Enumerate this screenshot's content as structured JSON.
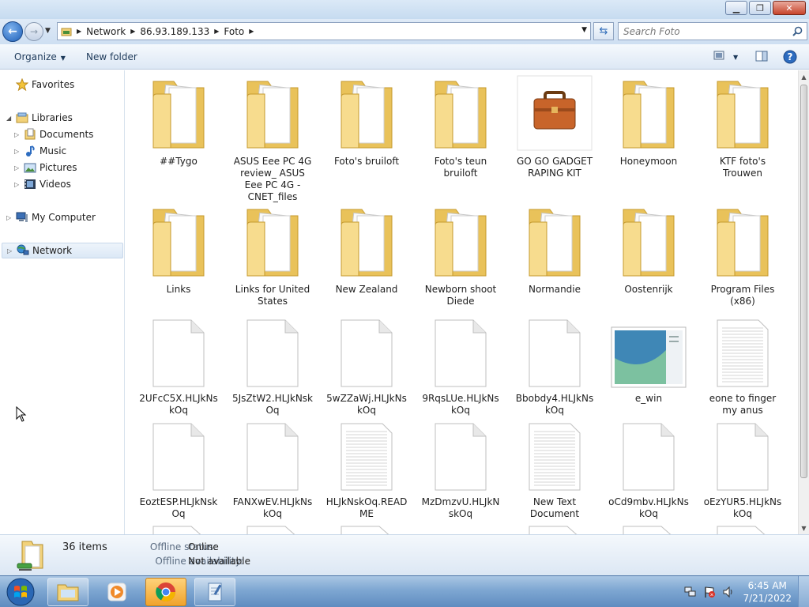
{
  "window": {
    "minimize_icon": "minimize-icon",
    "maximize_icon": "restore-icon",
    "close_icon": "close-icon"
  },
  "address": {
    "crumbs": [
      "Network",
      "86.93.189.133",
      "Foto"
    ],
    "search_placeholder": "Search Foto"
  },
  "toolbar": {
    "organize": "Organize",
    "new_folder": "New folder"
  },
  "nav": {
    "favorites": "Favorites",
    "libraries": "Libraries",
    "documents": "Documents",
    "music": "Music",
    "pictures": "Pictures",
    "videos": "Videos",
    "my_computer": "My Computer",
    "network": "Network"
  },
  "items": [
    {
      "label": "##Tygo",
      "kind": "folder"
    },
    {
      "label": "ASUS Eee PC 4G review_ ASUS Eee PC 4G - CNET_files",
      "kind": "folder"
    },
    {
      "label": "Foto's bruiloft",
      "kind": "folder"
    },
    {
      "label": "Foto's teun bruiloft",
      "kind": "folder"
    },
    {
      "label": "GO GO GADGET RAPING KIT",
      "kind": "briefcase"
    },
    {
      "label": "Honeymoon",
      "kind": "folder"
    },
    {
      "label": "KTF foto's Trouwen",
      "kind": "folder"
    },
    {
      "label": "Links",
      "kind": "folder"
    },
    {
      "label": "Links for United States",
      "kind": "folder"
    },
    {
      "label": "New Zealand",
      "kind": "folder"
    },
    {
      "label": "Newborn shoot Diede",
      "kind": "folder"
    },
    {
      "label": "Normandie",
      "kind": "folder"
    },
    {
      "label": "Oostenrijk",
      "kind": "folder"
    },
    {
      "label": "Program Files (x86)",
      "kind": "folder"
    },
    {
      "label": "2UFcC5X.HLJkNskOq",
      "kind": "file"
    },
    {
      "label": "5JsZtW2.HLJkNskOq",
      "kind": "file"
    },
    {
      "label": "5wZZaWj.HLJkNskOq",
      "kind": "file"
    },
    {
      "label": "9RqsLUe.HLJkNskOq",
      "kind": "file"
    },
    {
      "label": "Bbobdy4.HLJkNskOq",
      "kind": "file"
    },
    {
      "label": "e_win",
      "kind": "image"
    },
    {
      "label": "eone to finger my anus",
      "kind": "text"
    },
    {
      "label": "EoztESP.HLJkNskOq",
      "kind": "file"
    },
    {
      "label": "FANXwEV.HLJkNskOq",
      "kind": "file"
    },
    {
      "label": "HLJkNskOq.README",
      "kind": "text"
    },
    {
      "label": "MzDmzvU.HLJkNskOq",
      "kind": "file"
    },
    {
      "label": "New Text Document",
      "kind": "text"
    },
    {
      "label": "oCd9mbv.HLJkNskOq",
      "kind": "file"
    },
    {
      "label": "oEzYUR5.HLJkNskOq",
      "kind": "file"
    }
  ],
  "details": {
    "count": "36 items",
    "offline_status_label": "Offline status:",
    "offline_status_value": "Online",
    "offline_avail_label": "Offline availability:",
    "offline_avail_value": "Not available"
  },
  "clock": {
    "time": "6:45 AM",
    "date": "7/21/2022"
  },
  "colors": {
    "folder": "#f2d27a",
    "accent": "#1d5fb8"
  }
}
